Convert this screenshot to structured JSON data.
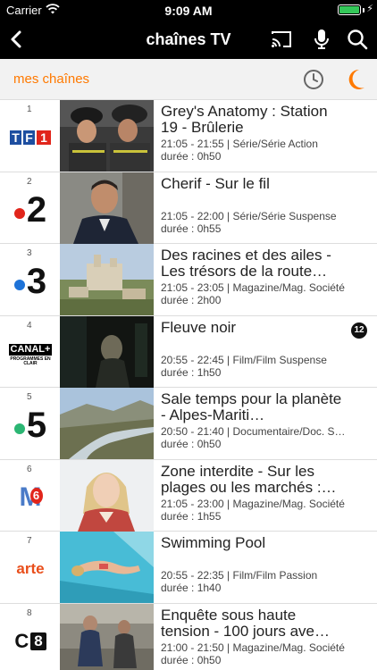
{
  "status_bar": {
    "carrier": "Carrier",
    "time": "9:09 AM",
    "battery_level": 1.0
  },
  "nav": {
    "title": "chaînes TV",
    "back_icon": "chevron-left-icon",
    "cast_icon": "cast-icon",
    "mic_icon": "microphone-icon",
    "search_icon": "search-icon"
  },
  "filter": {
    "label": "mes chaînes",
    "clock_icon": "clock-icon",
    "moon_icon": "moon-icon"
  },
  "colors": {
    "accent": "#ff7900",
    "tf1_blue": "#1d4ea0",
    "tf1_red": "#e1251b",
    "france2_dot": "#e1251b",
    "france3_dot": "#1e73d8",
    "france5_dot": "#2bb673",
    "arte": "#e94e1b"
  },
  "channels": [
    {
      "number": "1",
      "logo": "TF1",
      "title": "Grey's Anatomy : Station 19 - Brûlerie",
      "schedule": "21:05 - 21:55 | Série/Série Action",
      "duration": "durée : 0h50"
    },
    {
      "number": "2",
      "logo": "2",
      "title": "Cherif - Sur le fil",
      "schedule": "21:05 - 22:00 | Série/Série Suspense",
      "duration": "durée : 0h55"
    },
    {
      "number": "3",
      "logo": "3",
      "title": "Des racines et des ailes - Les trésors de la route…",
      "schedule": "21:05 - 23:05 | Magazine/Mag. Société",
      "duration": "durée : 2h00"
    },
    {
      "number": "4",
      "logo_main": "CANAL+",
      "logo_sub": "PROGRAMMES EN CLAIR",
      "title": "Fleuve noir",
      "schedule": "20:55 - 22:45 | Film/Film Suspense",
      "duration": "durée : 1h50",
      "rating": "12"
    },
    {
      "number": "5",
      "logo": "5",
      "title": "Sale temps pour la planète - Alpes-Mariti…",
      "schedule": "20:50 - 21:40 | Documentaire/Doc. S…",
      "duration": "durée : 0h50"
    },
    {
      "number": "6",
      "logo_letter": "M",
      "logo_num": "6",
      "title": "Zone interdite - Sur les plages ou les marchés :…",
      "schedule": "21:05 - 23:00 | Magazine/Mag. Société",
      "duration": "durée : 1h55"
    },
    {
      "number": "7",
      "logo": "arte",
      "title": "Swimming Pool",
      "schedule": "20:55 - 22:35 | Film/Film Passion",
      "duration": "durée : 1h40"
    },
    {
      "number": "8",
      "logo_letter": "C",
      "logo_num": "8",
      "title": "Enquête sous haute tension - 100 jours ave…",
      "schedule": "21:00 - 21:50 | Magazine/Mag. Société",
      "duration": "durée : 0h50"
    }
  ]
}
